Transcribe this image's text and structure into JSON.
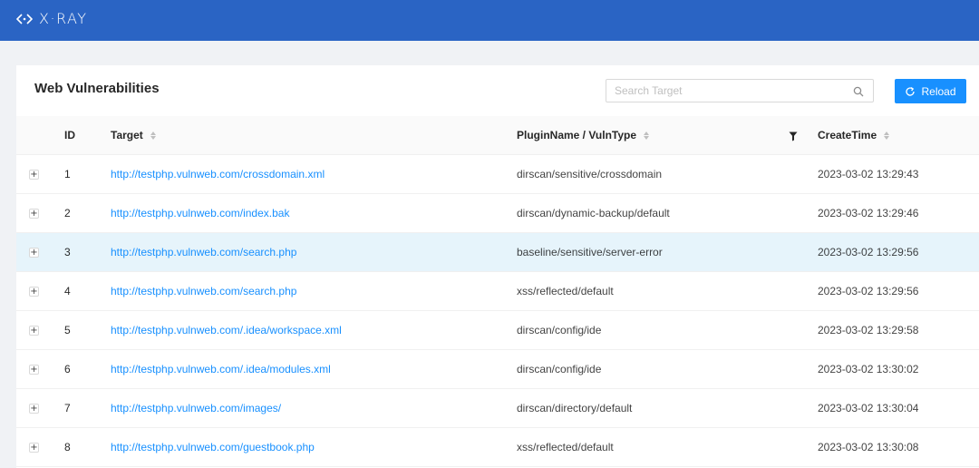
{
  "app": {
    "brand": "X·RAY",
    "logo_icon": "code-brackets-icon",
    "accent": "#1890ff",
    "header_color": "#2a64c4"
  },
  "panel": {
    "title": "Web Vulnerabilities",
    "search": {
      "placeholder": "Search Target",
      "value": "",
      "icon": "search-icon"
    },
    "reload_label": "Reload",
    "reload_icon": "reload-icon"
  },
  "table": {
    "columns": {
      "id": "ID",
      "target": "Target",
      "plugin": "PluginName / VulnType",
      "time": "CreateTime"
    },
    "rows": [
      {
        "id": "1",
        "target": "http://testphp.vulnweb.com/crossdomain.xml",
        "plugin": "dirscan/sensitive/crossdomain",
        "time": "2023-03-02 13:29:43"
      },
      {
        "id": "2",
        "target": "http://testphp.vulnweb.com/index.bak",
        "plugin": "dirscan/dynamic-backup/default",
        "time": "2023-03-02 13:29:46"
      },
      {
        "id": "3",
        "target": "http://testphp.vulnweb.com/search.php",
        "plugin": "baseline/sensitive/server-error",
        "time": "2023-03-02 13:29:56"
      },
      {
        "id": "4",
        "target": "http://testphp.vulnweb.com/search.php",
        "plugin": "xss/reflected/default",
        "time": "2023-03-02 13:29:56"
      },
      {
        "id": "5",
        "target": "http://testphp.vulnweb.com/.idea/workspace.xml",
        "plugin": "dirscan/config/ide",
        "time": "2023-03-02 13:29:58"
      },
      {
        "id": "6",
        "target": "http://testphp.vulnweb.com/.idea/modules.xml",
        "plugin": "dirscan/config/ide",
        "time": "2023-03-02 13:30:02"
      },
      {
        "id": "7",
        "target": "http://testphp.vulnweb.com/images/",
        "plugin": "dirscan/directory/default",
        "time": "2023-03-02 13:30:04"
      },
      {
        "id": "8",
        "target": "http://testphp.vulnweb.com/guestbook.php",
        "plugin": "xss/reflected/default",
        "time": "2023-03-02 13:30:08"
      }
    ],
    "expand_symbol": "+"
  }
}
